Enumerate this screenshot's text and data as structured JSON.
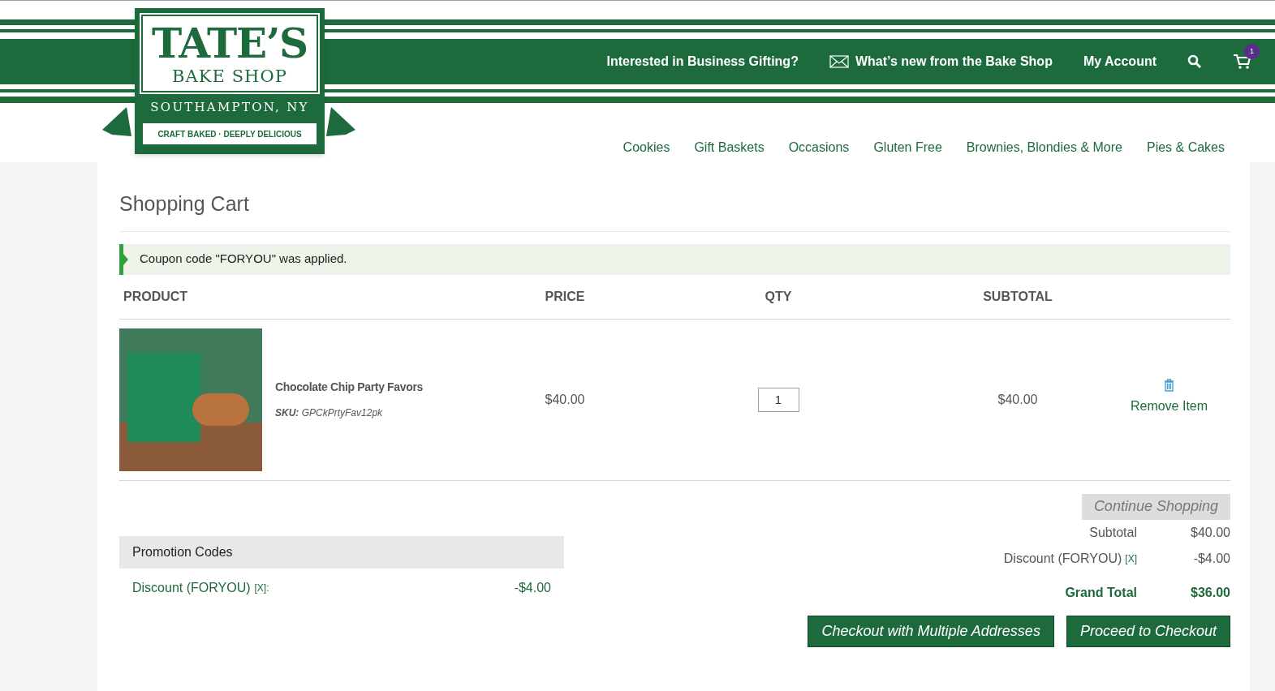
{
  "logo": {
    "name": "TATE’S",
    "subtitle": "BAKE SHOP",
    "location": "SOUTHAMPTON, NY",
    "tagline": "CRAFT BAKED · DEEPLY DELICIOUS"
  },
  "top_links": [
    {
      "label": "Interested in Business Gifting?",
      "kind": "text"
    },
    {
      "label": "What’s new from the Bake Shop",
      "kind": "mail"
    },
    {
      "label": "My Account",
      "kind": "text"
    }
  ],
  "cart_count": "1",
  "nav": [
    "Cookies",
    "Gift Baskets",
    "Occasions",
    "Gluten Free",
    "Brownies, Blondies & More",
    "Pies & Cakes"
  ],
  "page_title": "Shopping Cart",
  "message": "Coupon code \"FORYOU\" was applied.",
  "table": {
    "columns": [
      "PRODUCT",
      "PRICE",
      "QTY",
      "SUBTOTAL"
    ],
    "rows": [
      {
        "name": "Chocolate Chip Party Favors",
        "sku_label": "SKU:",
        "sku": "GPCkPrtyFav12pk",
        "price": "$40.00",
        "qty": "1",
        "subtotal": "$40.00",
        "remove": "Remove Item"
      }
    ]
  },
  "continue_button": "Continue Shopping",
  "promotions": {
    "title": "Promotion Codes",
    "items": [
      {
        "label": "Discount (FORYOU)",
        "remove": "[X]:",
        "amount": "-$4.00"
      }
    ]
  },
  "totals": [
    {
      "label": "Subtotal",
      "value": "$40.00",
      "kind": "normal"
    },
    {
      "label": "Discount (FORYOU)",
      "remove": "[X]",
      "value": "-$4.00",
      "kind": "normal"
    },
    {
      "label": "Grand Total",
      "value": "$36.00",
      "kind": "grand"
    }
  ],
  "checkout_buttons": [
    "Checkout with Multiple Addresses",
    "Proceed to Checkout"
  ]
}
